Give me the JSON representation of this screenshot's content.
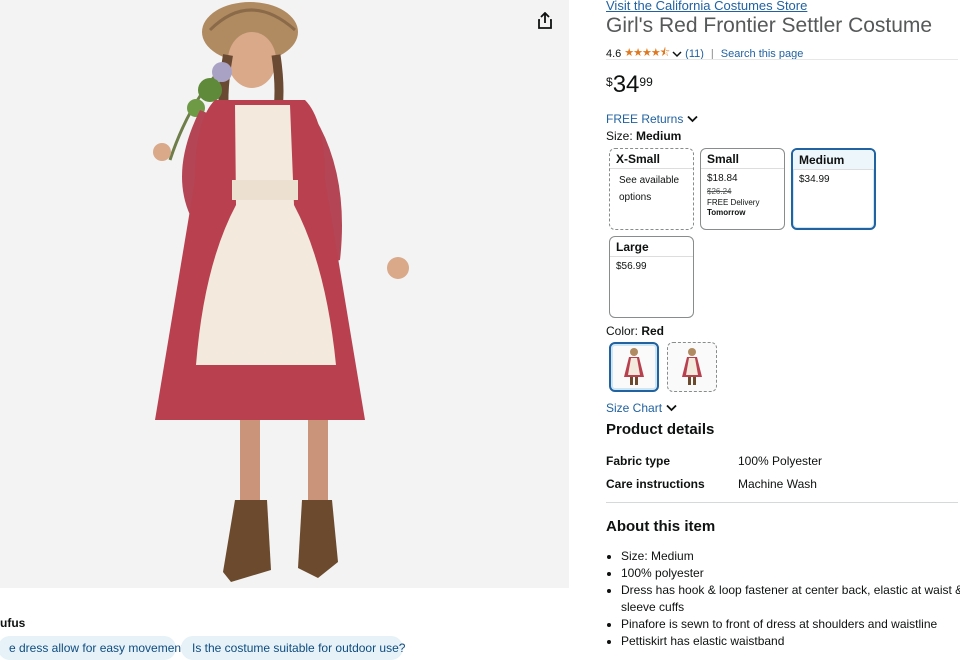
{
  "store_link": "Visit the California Costumes Store",
  "product_title": "Girl's Red Frontier Settler Costume",
  "rating": {
    "value": "4.6",
    "stars": 4.6,
    "count": "(11)",
    "divider": "|",
    "search_link": "Search this page"
  },
  "price": {
    "symbol": "$",
    "whole": "34",
    "fraction": "99"
  },
  "returns_label": "FREE Returns",
  "size": {
    "label": "Size: ",
    "selected": "Medium",
    "options": [
      {
        "name": "X-Small",
        "line1": "See available",
        "line2": "options"
      },
      {
        "name": "Small",
        "price": "$18.84",
        "list_price": "$26.24",
        "delivery": "FREE Delivery",
        "delivery_day": "Tomorrow"
      },
      {
        "name": "Medium",
        "price": "$34.99"
      },
      {
        "name": "Large",
        "price": "$56.99"
      }
    ]
  },
  "color": {
    "label": "Color: ",
    "selected": "Red"
  },
  "size_chart_label": "Size Chart",
  "product_details": {
    "heading": "Product details",
    "rows": [
      {
        "key": "Fabric type",
        "value": "100% Polyester"
      },
      {
        "key": "Care instructions",
        "value": "Machine Wash"
      }
    ]
  },
  "about": {
    "heading": "About this item",
    "bullets": [
      "Size: Medium",
      "100% polyester",
      "Dress has hook & loop fastener at center back, elastic at waist & sleeve cuffs",
      "Pinafore is sewn to front of dress at shoulders and waistline",
      "Pettiskirt has elastic waistband"
    ]
  },
  "rufus": {
    "label": "ufus",
    "chips": [
      "e dress allow for easy movement?",
      "Is the costume suitable for outdoor use?"
    ]
  },
  "icons": {
    "share": "share-icon",
    "dropdown": "chevron-down-icon"
  },
  "colors": {
    "link": "#2162a1",
    "star": "#de7921",
    "selected_border": "#2162a1",
    "chip_bg": "#e6f2f7"
  }
}
